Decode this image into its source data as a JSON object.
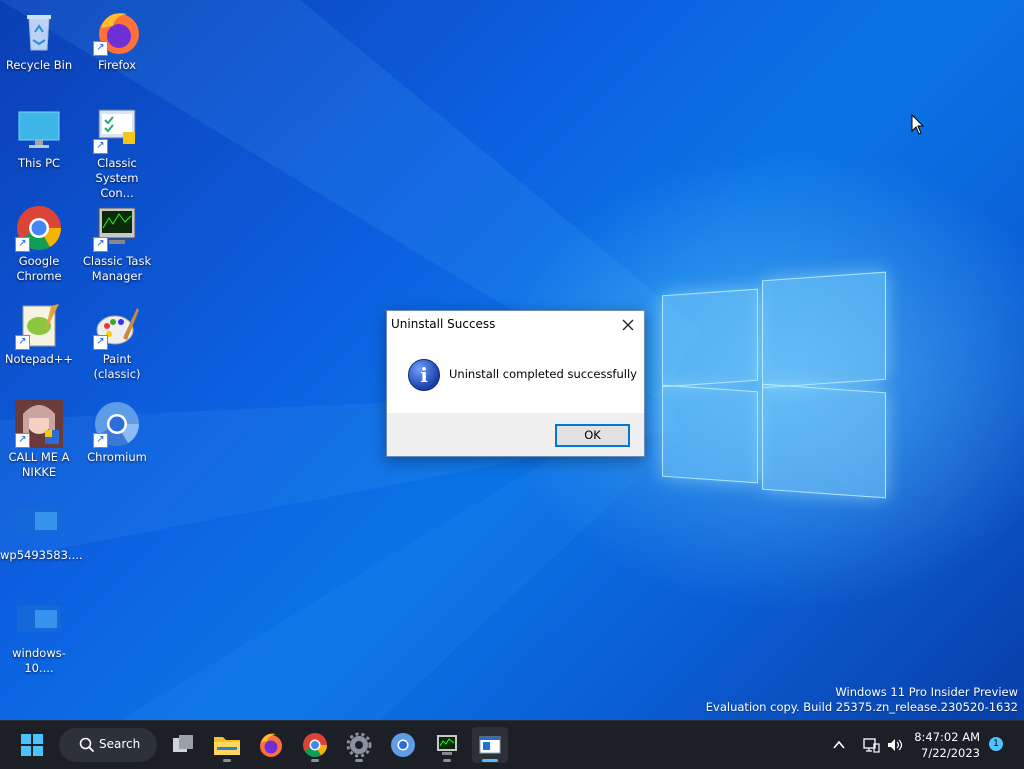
{
  "desktop": {
    "icons": [
      {
        "label": "Recycle Bin",
        "icon": "recycle-bin-icon"
      },
      {
        "label": "Firefox",
        "icon": "firefox-icon"
      },
      {
        "label": "This PC",
        "icon": "this-pc-icon"
      },
      {
        "label": "Classic System Con...",
        "icon": "control-panel-icon"
      },
      {
        "label": "Google Chrome",
        "icon": "chrome-icon"
      },
      {
        "label": "Classic Task Manager",
        "icon": "task-manager-icon"
      },
      {
        "label": "Notepad++",
        "icon": "notepadpp-icon"
      },
      {
        "label": "Paint (classic)",
        "icon": "paint-icon"
      },
      {
        "label": "CALL ME A NIKKE",
        "icon": "nikke-icon"
      },
      {
        "label": "Chromium",
        "icon": "chromium-icon"
      },
      {
        "label": "wp5493583....",
        "icon": "image-file-icon"
      },
      {
        "label": "windows-10....",
        "icon": "image-file-icon"
      }
    ]
  },
  "dialog": {
    "title": "Uninstall Success",
    "message": "Uninstall completed successfully",
    "ok_label": "OK",
    "info_glyph": "i"
  },
  "watermark": {
    "line1": "Windows 11 Pro Insider Preview",
    "line2": "Evaluation copy. Build 25375.zn_release.230520-1632"
  },
  "taskbar": {
    "search_label": "Search",
    "time": "8:47:02 AM",
    "date": "7/22/2023",
    "notification_count": "1",
    "apps": [
      "start",
      "search",
      "task-view",
      "file-explorer",
      "firefox",
      "chrome",
      "settings",
      "chromium",
      "task-manager",
      "active-app"
    ]
  },
  "colors": {
    "accent": "#4cc2ff",
    "wallpaper": "#0a5fd8",
    "taskbar": "#1c1f26"
  }
}
